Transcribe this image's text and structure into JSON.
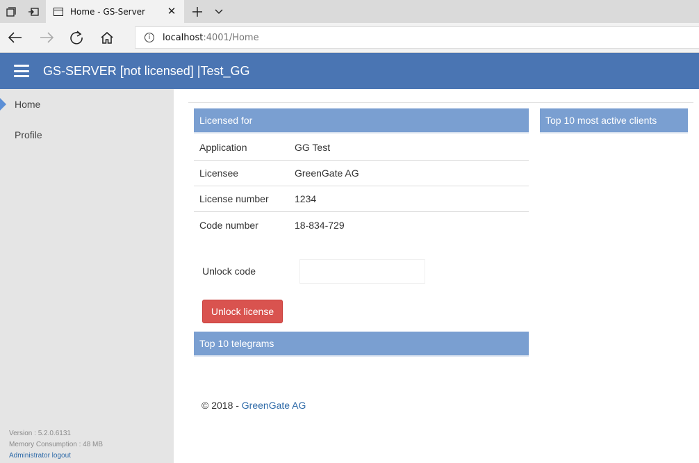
{
  "browser": {
    "tab_title": "Home - GS-Server",
    "address_host": "localhost",
    "address_path": ":4001/Home"
  },
  "header": {
    "title": "GS-SERVER [not licensed] |Test_GG"
  },
  "sidebar": {
    "items": [
      {
        "label": "Home",
        "active": true
      },
      {
        "label": "Profile",
        "active": false
      }
    ],
    "version": "Version : 5.2.0.6131",
    "memory": "Memory Consumption : 48 MB",
    "logout": "Administrator logout"
  },
  "license": {
    "heading": "Licensed for",
    "rows": [
      {
        "key": "Application",
        "value": "GG Test"
      },
      {
        "key": "Licensee",
        "value": "GreenGate AG"
      },
      {
        "key": "License number",
        "value": "1234"
      },
      {
        "key": "Code number",
        "value": "18-834-729"
      }
    ],
    "unlock_label": "Unlock code",
    "unlock_value": "",
    "unlock_button": "Unlock license"
  },
  "telegrams": {
    "heading": "Top 10 telegrams"
  },
  "clients": {
    "heading": "Top 10 most active clients"
  },
  "footer": {
    "copyright": "© 2018 - ",
    "brand": "GreenGate AG"
  },
  "colors": {
    "header_bg": "#4a75b3",
    "panel_head_bg": "#7a9fd1",
    "unlock_button_bg": "#d9534f",
    "link": "#2e6aa8"
  }
}
